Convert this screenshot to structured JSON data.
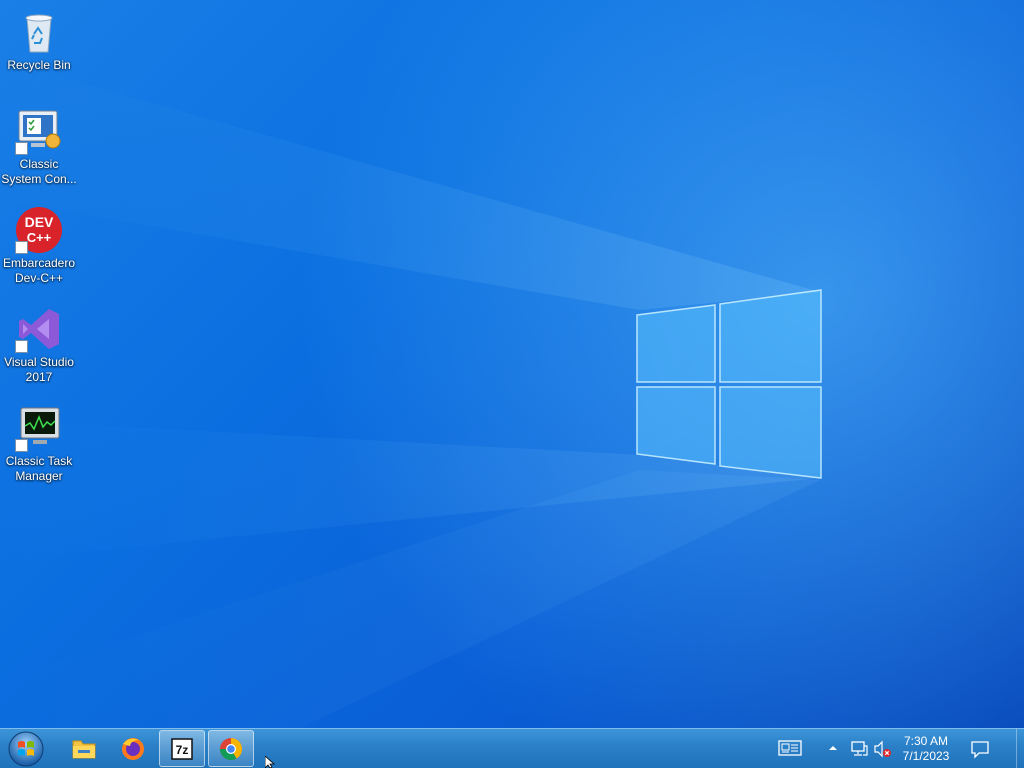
{
  "desktop": {
    "icons": [
      {
        "label": "Recycle Bin",
        "icon": "recycle-bin-icon"
      },
      {
        "label": "Classic\nSystem Con...",
        "icon": "control-panel-icon"
      },
      {
        "label": "Embarcadero\nDev-C++",
        "icon": "devcpp-icon",
        "icon_text": "DEV C++"
      },
      {
        "label": "Visual Studio\n2017",
        "icon": "visual-studio-icon"
      },
      {
        "label": "Classic Task\nManager",
        "icon": "task-manager-icon"
      }
    ]
  },
  "taskbar": {
    "pinned": [
      {
        "name": "file-explorer",
        "icon": "folder-icon",
        "active": false
      },
      {
        "name": "firefox",
        "icon": "firefox-icon",
        "active": false
      },
      {
        "name": "7zip",
        "icon": "7zip-icon",
        "label": "7z",
        "active": true
      },
      {
        "name": "chrome",
        "icon": "chrome-icon",
        "active": true
      }
    ],
    "tray": {
      "icons": [
        "news-icon",
        "chevron-up-icon",
        "network-icon",
        "volume-muted-icon"
      ],
      "time": "7:30 AM",
      "date": "7/1/2023",
      "notification_icon": "action-center-icon"
    }
  },
  "colors": {
    "desktop_bg": "#0b6fe0",
    "taskbar_bg": "#2a7fc6",
    "devcpp_red": "#d8232a",
    "vs_purple": "#8c5ad8"
  }
}
